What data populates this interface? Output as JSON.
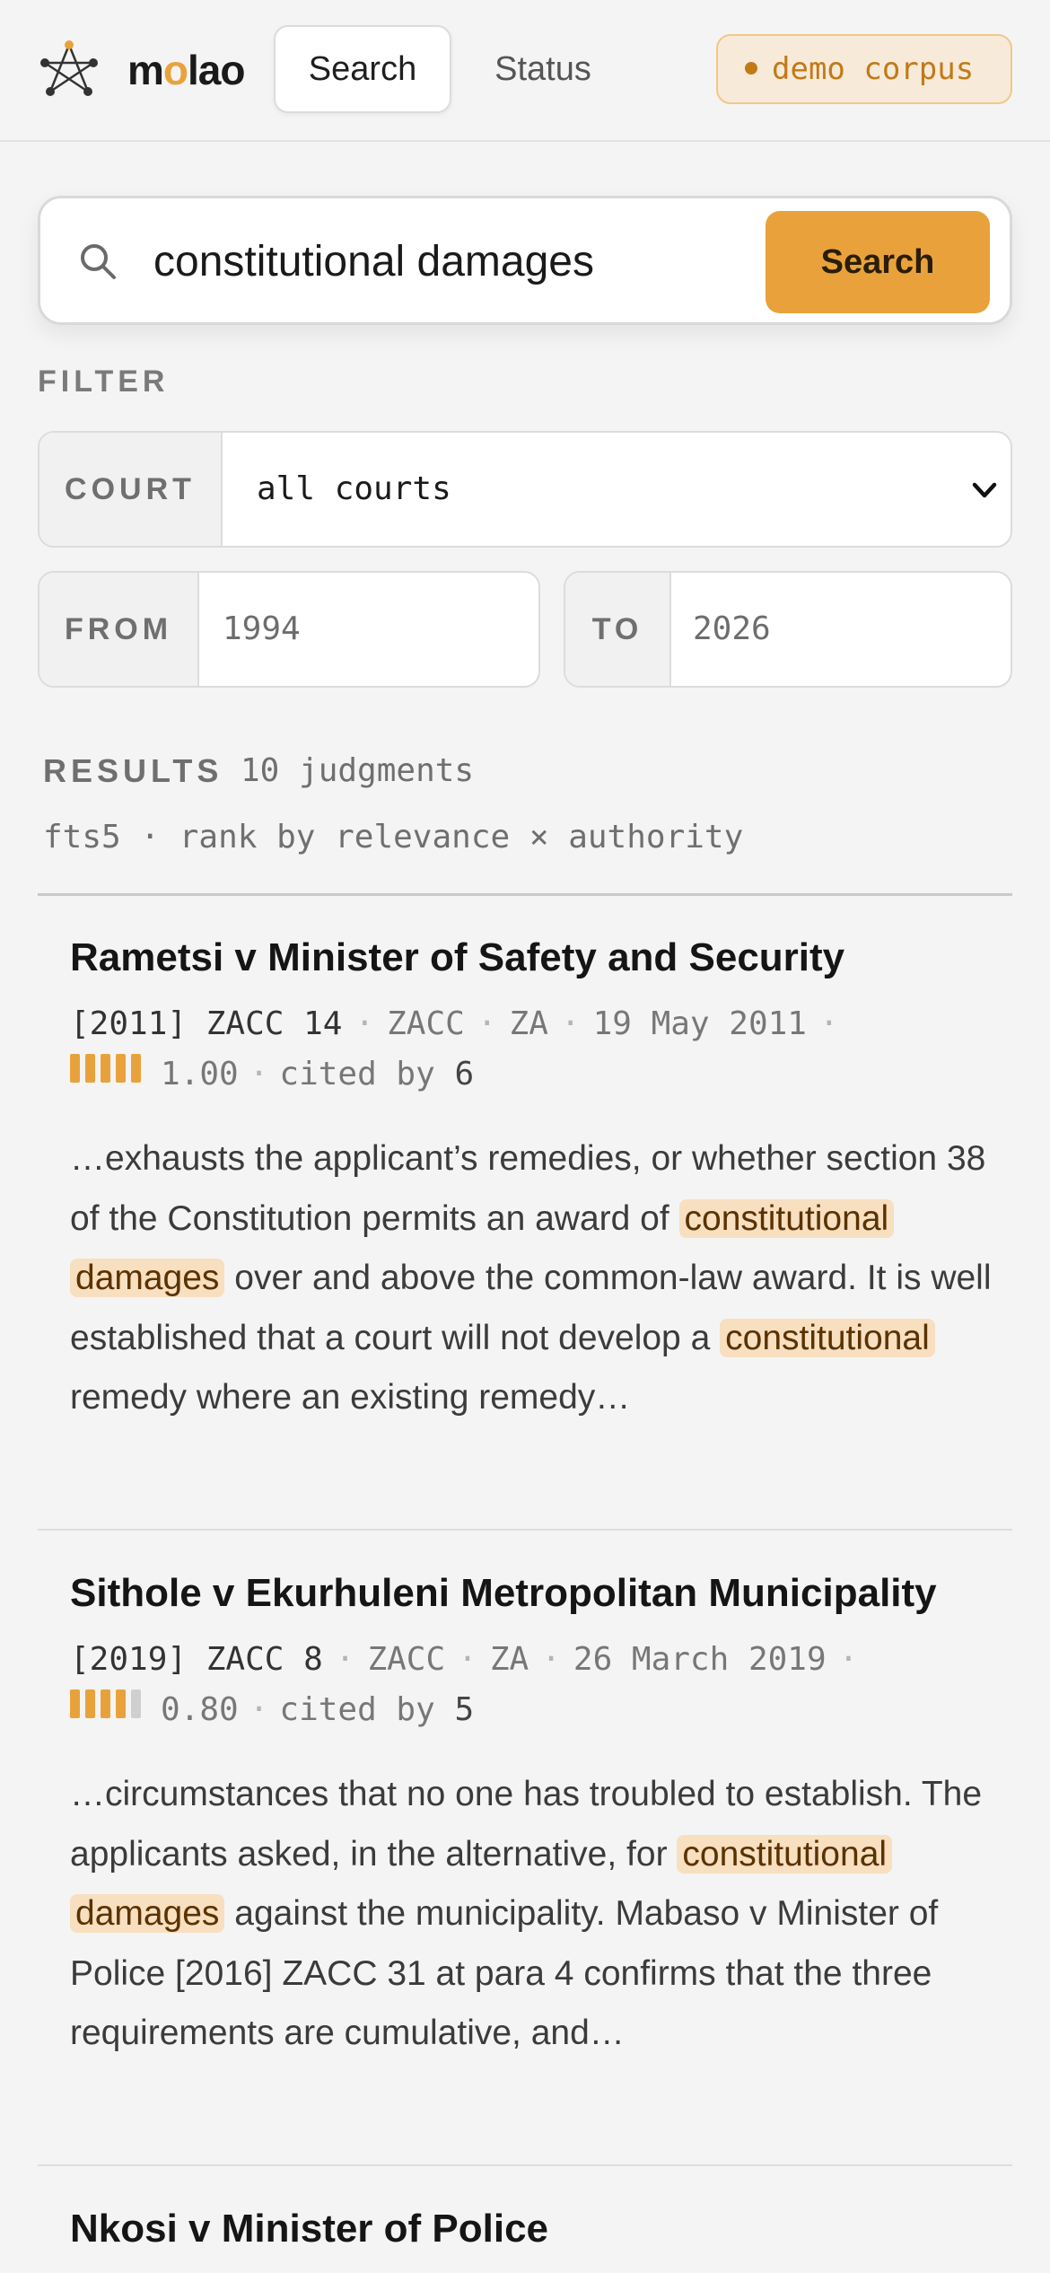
{
  "header": {
    "brand": {
      "pre": "m",
      "accent": "o",
      "post": "lao"
    },
    "tabs": [
      {
        "label": "Search",
        "active": true
      },
      {
        "label": "Status",
        "active": false
      }
    ],
    "badge": "demo corpus",
    "icons": {
      "logo": "network-star-logo"
    }
  },
  "search": {
    "value": "constitutional damages",
    "button_label": "Search",
    "icon": "search-icon"
  },
  "filter": {
    "label": "FILTER",
    "court_label": "COURT",
    "court_value": "all courts",
    "from_label": "FROM",
    "from_value": "1994",
    "to_label": "TO",
    "to_value": "2026"
  },
  "results": {
    "label": "RESULTS",
    "count": "10 judgments",
    "meta": "fts5 · rank by relevance × authority",
    "items": [
      {
        "title": "Rametsi v Minister of Safety and Security",
        "citation": "[2011] ZACC 14",
        "court": "ZACC",
        "jurisdiction": "ZA",
        "date": "19 May 2011",
        "score": "1.00",
        "score_fraction": 1.0,
        "cited_by_label": "cited by",
        "cited_by": "6",
        "snippet": {
          "s1": "…exhausts the applicant’s remedies, or whether section 38 of the Constitution permits an award of",
          "h1": "constitutional",
          "h2": "damages",
          "s2": "over and above the common-law award. It is well established that a court will not develop a",
          "h3": "constitutional",
          "s3": "remedy where an existing remedy…"
        }
      },
      {
        "title": "Sithole v Ekurhuleni Metropolitan Municipality",
        "citation": "[2019] ZACC 8",
        "court": "ZACC",
        "jurisdiction": "ZA",
        "date": "26 March 2019",
        "score": "0.80",
        "score_fraction": 0.8,
        "cited_by_label": "cited by",
        "cited_by": "5",
        "snippet": {
          "s1": "…circumstances that no one has troubled to establish. The applicants asked, in the alternative, for",
          "h1": "constitutional",
          "h2": "damages",
          "s2": "against the municipality. Mabaso v Minister of Police [2016] ZACC 31 at para 4 confirms that the three requirements are cumulative, and…"
        }
      },
      {
        "title": "Nkosi v Minister of Police"
      }
    ]
  },
  "colors": {
    "accent": "#e9a23b",
    "highlight": "#f7dfc0",
    "badge_bg": "#f7ead9",
    "badge_text": "#c27a17"
  }
}
